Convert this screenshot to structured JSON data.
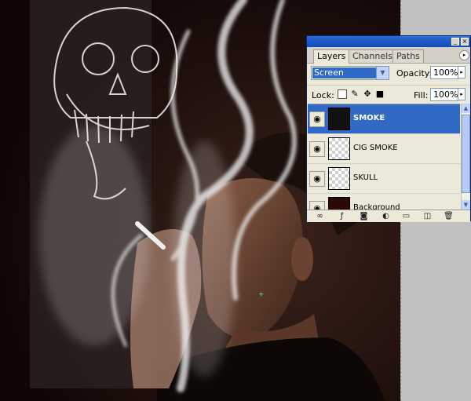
{
  "panel": {
    "tabs": [
      {
        "label": "Layers",
        "active": true
      },
      {
        "label": "Channels",
        "active": false
      },
      {
        "label": "Paths",
        "active": false
      }
    ],
    "blend_mode": "Screen",
    "opacity_label": "Opacity:",
    "opacity_value": "100%",
    "lock_label": "Lock:",
    "fill_label": "Fill:",
    "fill_value": "100%",
    "layers": [
      {
        "name": "SMOKE",
        "selected": true,
        "visible": true
      },
      {
        "name": "CIG SMOKE",
        "selected": false,
        "visible": true
      },
      {
        "name": "SKULL",
        "selected": false,
        "visible": true
      },
      {
        "name": "Background",
        "selected": false,
        "visible": false
      }
    ],
    "accent_color": "#316ac5",
    "titlebar_color": "#1f5ad0"
  },
  "icons": {
    "lock": [
      "lock-transparent-icon",
      "lock-paint-icon",
      "lock-move-icon",
      "lock-all-icon"
    ],
    "bottom": [
      "link-layers-icon",
      "layer-style-icon",
      "layer-mask-icon",
      "adjustment-layer-icon",
      "new-group-icon",
      "new-layer-icon",
      "delete-layer-icon"
    ]
  }
}
